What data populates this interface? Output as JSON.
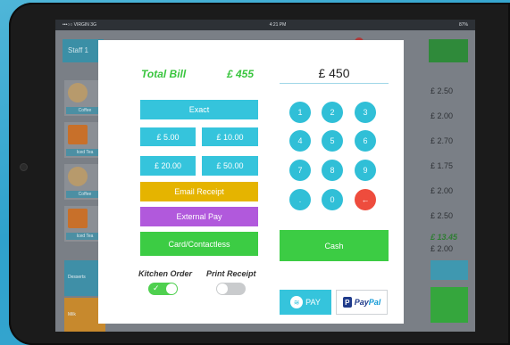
{
  "statusbar": {
    "carrier": "•••○○ VIRGIN 3G",
    "time": "4:21 PM",
    "battery": "87%"
  },
  "background": {
    "header_label": "Staff 1",
    "items": [
      {
        "caption": "Coffee"
      },
      {
        "caption": "Iced Tea"
      },
      {
        "caption": "Coffee"
      },
      {
        "caption": "Iced Tea"
      }
    ],
    "prices": [
      "£ 2.50",
      "£ 2.00",
      "£ 2.70",
      "£ 1.75",
      "£ 2.00",
      "£ 2.50"
    ],
    "total_green": "£ 13.45",
    "total_black": "£ 2.00",
    "bottom_buttons": [
      "Desserts",
      "Milk"
    ]
  },
  "payment": {
    "total_label": "Total Bill",
    "total_value": "£ 455",
    "amount_field": "£ 450",
    "exact_label": "Exact",
    "quick_amounts": [
      "£ 5.00",
      "£ 10.00",
      "£ 20.00",
      "£ 50.00"
    ],
    "email_receipt_label": "Email Receipt",
    "external_pay_label": "External Pay",
    "card_label": "Card/Contactless",
    "cash_label": "Cash",
    "keypad": [
      "1",
      "2",
      "3",
      "4",
      "5",
      "6",
      "7",
      "8",
      "9",
      ".",
      "0",
      "←"
    ],
    "kitchen_order": {
      "label": "Kitchen Order",
      "on": true
    },
    "print_receipt": {
      "label": "Print Receipt",
      "on": false
    },
    "samsung_pay": {
      "icon": "samsung-pay-icon",
      "label": "PAY"
    },
    "paypal": {
      "icon": "paypal-icon",
      "label_dark": "Pay",
      "label_light": "Pal"
    }
  },
  "colors": {
    "accent_cyan": "#35c4dc",
    "keypad_cyan": "#30bfd7",
    "green": "#3ccc44",
    "yellow": "#e5b400",
    "purple": "#b159dc",
    "back_red": "#ee4c3d",
    "total_green": "#39c53e"
  }
}
